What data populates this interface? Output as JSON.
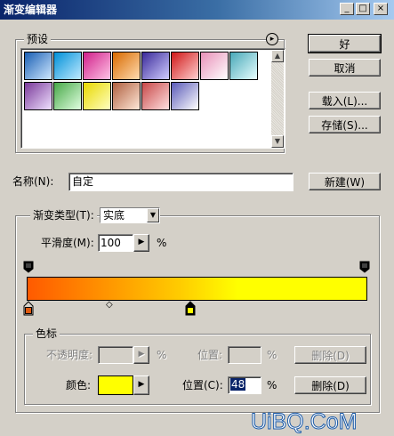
{
  "window": {
    "title": "渐变编辑器",
    "minimize_glyph": "_",
    "maximize_glyph": "□",
    "close_glyph": "×"
  },
  "presets": {
    "legend": "预设",
    "menu_glyph": "▸",
    "row1": [
      {
        "icon": "preset-blue",
        "from": "#1a5fb4",
        "to": "#cfe8ff"
      },
      {
        "icon": "preset-cyan",
        "from": "#0090d8",
        "to": "#bfeaff"
      },
      {
        "icon": "preset-magenta",
        "from": "#d0208a",
        "to": "#ffc3e6"
      },
      {
        "icon": "preset-orange",
        "from": "#d86a00",
        "to": "#ffdcb0"
      },
      {
        "icon": "preset-indigo",
        "from": "#3a2a9a",
        "to": "#d0ccff"
      },
      {
        "icon": "preset-red",
        "from": "#d01818",
        "to": "#ffd0d0"
      },
      {
        "icon": "preset-pink",
        "from": "#e890b8",
        "to": "#ffffff"
      },
      {
        "icon": "preset-teal",
        "from": "#48a8b8",
        "to": "#e8ffff"
      }
    ],
    "row2": [
      {
        "icon": "preset-purple",
        "from": "#7a3a9a",
        "to": "#f0e0ff"
      },
      {
        "icon": "preset-green",
        "from": "#48a848",
        "to": "#e0ffe0"
      },
      {
        "icon": "preset-yellow",
        "from": "#e8d800",
        "to": "#ffffc0"
      },
      {
        "icon": "preset-brown",
        "from": "#b06040",
        "to": "#ffe8d8"
      },
      {
        "icon": "preset-rose",
        "from": "#c84848",
        "to": "#ffe0e0"
      },
      {
        "icon": "preset-lavender",
        "from": "#5a5ab8",
        "to": "#ffffff"
      }
    ]
  },
  "buttons": {
    "ok": "好",
    "cancel": "取消",
    "load": "载入(L)...",
    "save": "存储(S)...",
    "new": "新建(W)"
  },
  "name": {
    "label": "名称(N):",
    "value": "自定"
  },
  "gradient_type": {
    "label": "渐变类型(T):",
    "value": "实底",
    "arrow": "▼"
  },
  "smoothness": {
    "label": "平滑度(M):",
    "value": "100",
    "arrow": "▶",
    "unit": "%"
  },
  "gradient": {
    "start_color": "#ff5a00",
    "end_color": "#ffff00",
    "stop_left_color": "#e05a10",
    "stop_right_color": "#ffff00",
    "midpoint_glyph": "◇"
  },
  "color_stops": {
    "legend": "色标",
    "opacity_label": "不透明度:",
    "opacity_unit": "%",
    "opacity_arrow": "▶",
    "location_label_disabled": "位置:",
    "location_unit_disabled": "%",
    "delete_disabled": "删除(D)",
    "color_label": "颜色:",
    "color_value": "#ffff00",
    "color_arrow": "▶",
    "location_label": "位置(C):",
    "location_value": "48",
    "location_unit": "%",
    "delete": "删除(D)"
  },
  "watermark": "UiBQ.CoM"
}
